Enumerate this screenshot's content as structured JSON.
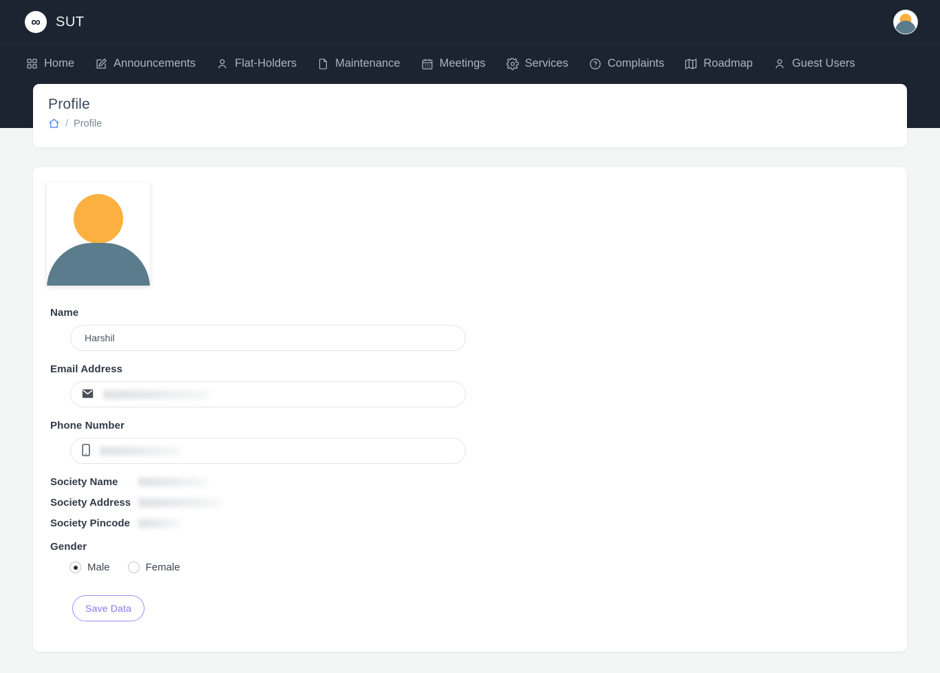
{
  "brand": {
    "logo_icon": "infinity-icon",
    "logo_glyph": "∞",
    "name": "SUT"
  },
  "navbar": {
    "avatar_icon": "user-avatar",
    "items": [
      {
        "label": "Home",
        "icon": "grid-icon"
      },
      {
        "label": "Announcements",
        "icon": "edit-square-icon"
      },
      {
        "label": "Flat-Holders",
        "icon": "user-icon"
      },
      {
        "label": "Maintenance",
        "icon": "file-icon"
      },
      {
        "label": "Meetings",
        "icon": "calendar-icon"
      },
      {
        "label": "Services",
        "icon": "gear-icon"
      },
      {
        "label": "Complaints",
        "icon": "question-circle-icon"
      },
      {
        "label": "Roadmap",
        "icon": "map-icon"
      },
      {
        "label": "Guest Users",
        "icon": "user-icon"
      }
    ]
  },
  "page_header": {
    "title": "Profile",
    "breadcrumb": {
      "home_icon": "home-icon",
      "separator": "/",
      "current": "Profile"
    }
  },
  "profile": {
    "photo_icon": "user-avatar-placeholder",
    "fields": {
      "name": {
        "label": "Name",
        "value": "Harshil",
        "placeholder": "Name"
      },
      "email": {
        "label": "Email Address",
        "value": "",
        "redacted": true,
        "icon": "envelope-icon",
        "redacted_width": 155
      },
      "phone": {
        "label": "Phone Number",
        "value": "",
        "redacted": true,
        "icon": "mobile-icon",
        "redacted_width": 118
      }
    },
    "info_rows": [
      {
        "label": "Society Name",
        "value": "",
        "redacted": true,
        "redacted_width": 100
      },
      {
        "label": "Society Address",
        "value": "",
        "redacted": true,
        "redacted_width": 120
      },
      {
        "label": "Society Pincode",
        "value": "",
        "redacted": true,
        "redacted_width": 60
      }
    ],
    "gender": {
      "label": "Gender",
      "options": [
        {
          "label": "Male",
          "selected": true
        },
        {
          "label": "Female",
          "selected": false
        }
      ]
    },
    "save_label": "Save Data"
  },
  "colors": {
    "navbar_bg": "#1b2430",
    "page_bg": "#f4f5f5",
    "card_bg": "#ffffff",
    "nav_text": "#aab6c3",
    "title_text": "#3c4858",
    "label_text": "#323a47",
    "accent_purple": "#a78bfa",
    "breadcrumb_home": "#3b82f6",
    "avatar_head": "#fbb040",
    "avatar_body": "#5a7c8c"
  }
}
